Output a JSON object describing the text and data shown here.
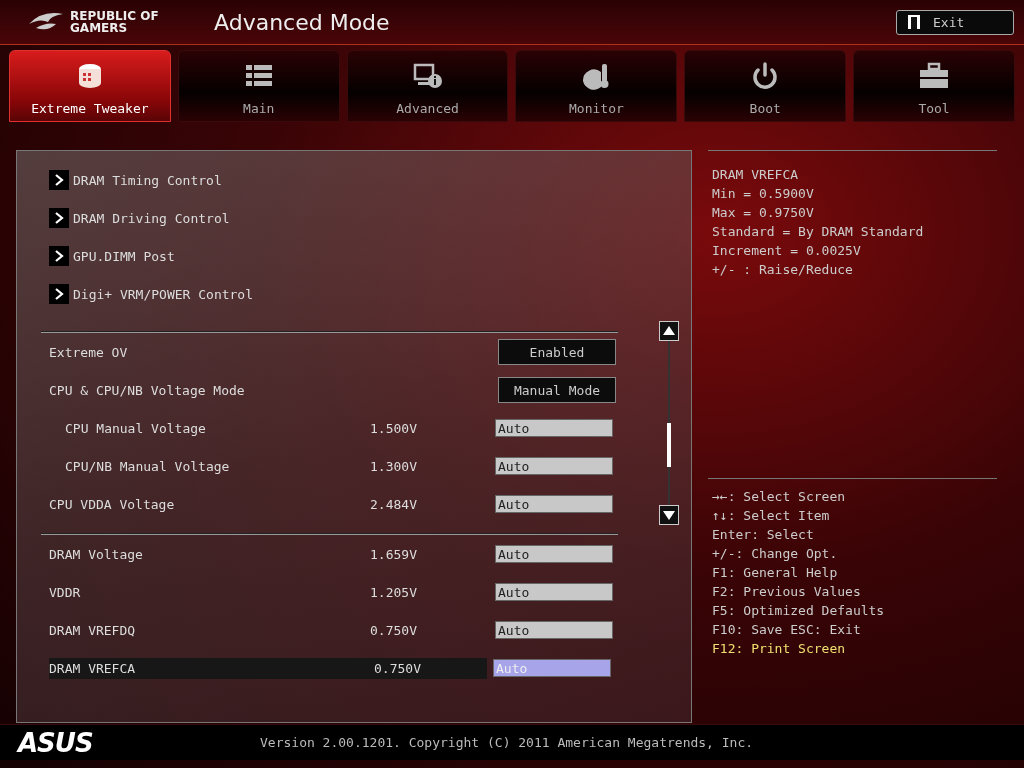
{
  "header": {
    "logo_line_1": "REPUBLIC OF",
    "logo_line_2": "GAMERS",
    "title": "Advanced Mode",
    "exit_button": "Exit"
  },
  "tabs": [
    {
      "label": "Extreme Tweaker",
      "kind": "tweaker",
      "selected": true
    },
    {
      "label": "Main",
      "kind": "list",
      "selected": false
    },
    {
      "label": "Advanced",
      "kind": "advanced",
      "selected": false
    },
    {
      "label": "Monitor",
      "kind": "monitor",
      "selected": false
    },
    {
      "label": "Boot",
      "kind": "power",
      "selected": false
    },
    {
      "label": "Tool",
      "kind": "toolbox",
      "selected": false
    }
  ],
  "submenus": [
    "DRAM Timing Control",
    "DRAM Driving Control",
    "GPU.DIMM Post",
    "Digi+ VRM/POWER Control"
  ],
  "setting_groups": [
    [
      {
        "kind": "option",
        "label": "Extreme OV",
        "value": "Enabled",
        "selected": false
      },
      {
        "kind": "option",
        "label": "CPU & CPU/NB Voltage Mode",
        "value": "Manual Mode",
        "selected": false,
        "children": [
          {
            "kind": "voltage",
            "label": "CPU Manual Voltage",
            "reading": "1.500V",
            "value": "Auto",
            "selected": false
          },
          {
            "kind": "voltage",
            "label": "CPU/NB Manual Voltage",
            "reading": "1.300V",
            "value": "Auto",
            "selected": false
          }
        ]
      },
      {
        "kind": "voltage",
        "label": "CPU VDDA Voltage",
        "reading": "2.484V",
        "value": "Auto",
        "selected": false
      }
    ],
    [
      {
        "kind": "voltage",
        "label": "DRAM Voltage",
        "reading": "1.659V",
        "value": "Auto",
        "selected": false
      },
      {
        "kind": "voltage",
        "label": "VDDR",
        "reading": "1.205V",
        "value": "Auto",
        "selected": false
      },
      {
        "kind": "voltage",
        "label": "DRAM VREFDQ",
        "reading": "0.750V",
        "value": "Auto",
        "selected": false
      },
      {
        "kind": "voltage",
        "label": "DRAM VREFCA",
        "reading": "0.750V",
        "value": "Auto",
        "selected": true
      }
    ]
  ],
  "item_help": [
    "DRAM VREFCA",
    "Min = 0.5900V",
    "Max = 0.9750V",
    "Standard = By DRAM Standard",
    "Increment = 0.0025V",
    "+/- : Raise/Reduce"
  ],
  "key_help": [
    {
      "text": "→←: Select Screen",
      "highlighted": false
    },
    {
      "text": "↑↓: Select Item",
      "highlighted": false
    },
    {
      "text": "Enter: Select",
      "highlighted": false
    },
    {
      "text": "+/-: Change Opt.",
      "highlighted": false
    },
    {
      "text": "F1: General Help",
      "highlighted": false
    },
    {
      "text": "F2: Previous Values",
      "highlighted": false
    },
    {
      "text": "F5: Optimized Defaults",
      "highlighted": false
    },
    {
      "text": "F10: Save  ESC: Exit",
      "highlighted": false
    },
    {
      "text": "F12: Print Screen",
      "highlighted": true
    }
  ],
  "footer": {
    "logo": "ASUS",
    "version": "Version 2.00.1201. Copyright (C) 2011 American Megatrends, Inc."
  }
}
